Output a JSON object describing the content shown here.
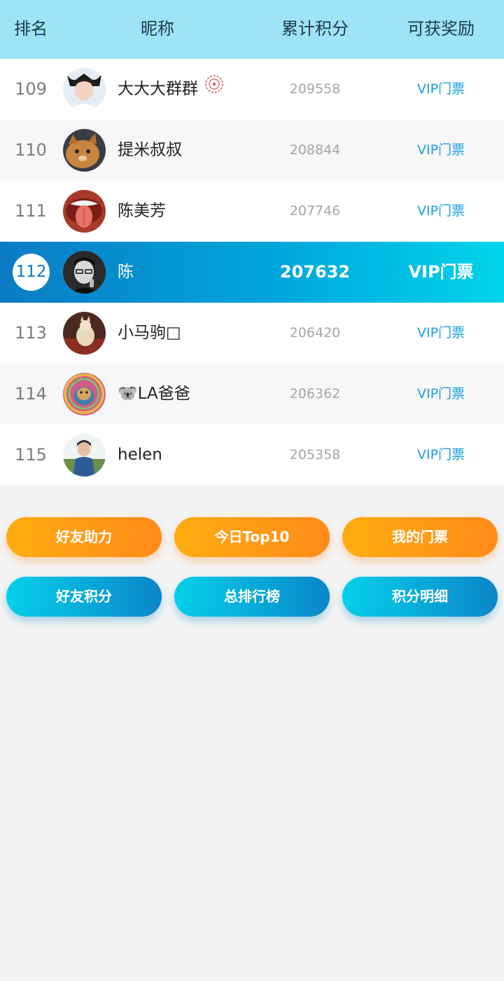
{
  "header": {
    "rank": "排名",
    "nickname": "昵称",
    "points": "累计积分",
    "reward": "可获奖励"
  },
  "rows": [
    {
      "rank": "109",
      "name": "大大大群群",
      "points": "209558",
      "reward": "VIP门票"
    },
    {
      "rank": "110",
      "name": "提米叔叔",
      "points": "208844",
      "reward": "VIP门票"
    },
    {
      "rank": "111",
      "name": "陈美芳",
      "points": "207746",
      "reward": "VIP门票"
    },
    {
      "rank": "112",
      "name": "陈",
      "points": "207632",
      "reward": "VIP门票"
    },
    {
      "rank": "113",
      "name": "小马驹□",
      "points": "206420",
      "reward": "VIP门票"
    },
    {
      "rank": "114",
      "name": "🐨LA爸爸",
      "points": "206362",
      "reward": "VIP门票"
    },
    {
      "rank": "115",
      "name": "helen",
      "points": "205358",
      "reward": "VIP门票"
    }
  ],
  "buttons": {
    "friend_help": "好友助力",
    "today_top10": "今日Top10",
    "my_tickets": "我的门票",
    "friend_points": "好友积分",
    "overall_ranking": "总排行榜",
    "points_detail": "积分明细"
  },
  "colors": {
    "header_bg": "#9ee3f7",
    "highlight_start": "#0b7bc4",
    "highlight_end": "#00d4ea",
    "reward_text": "#1a9fe0",
    "orange_button": "#ff8a1a",
    "blue_button": "#0a86c8"
  }
}
